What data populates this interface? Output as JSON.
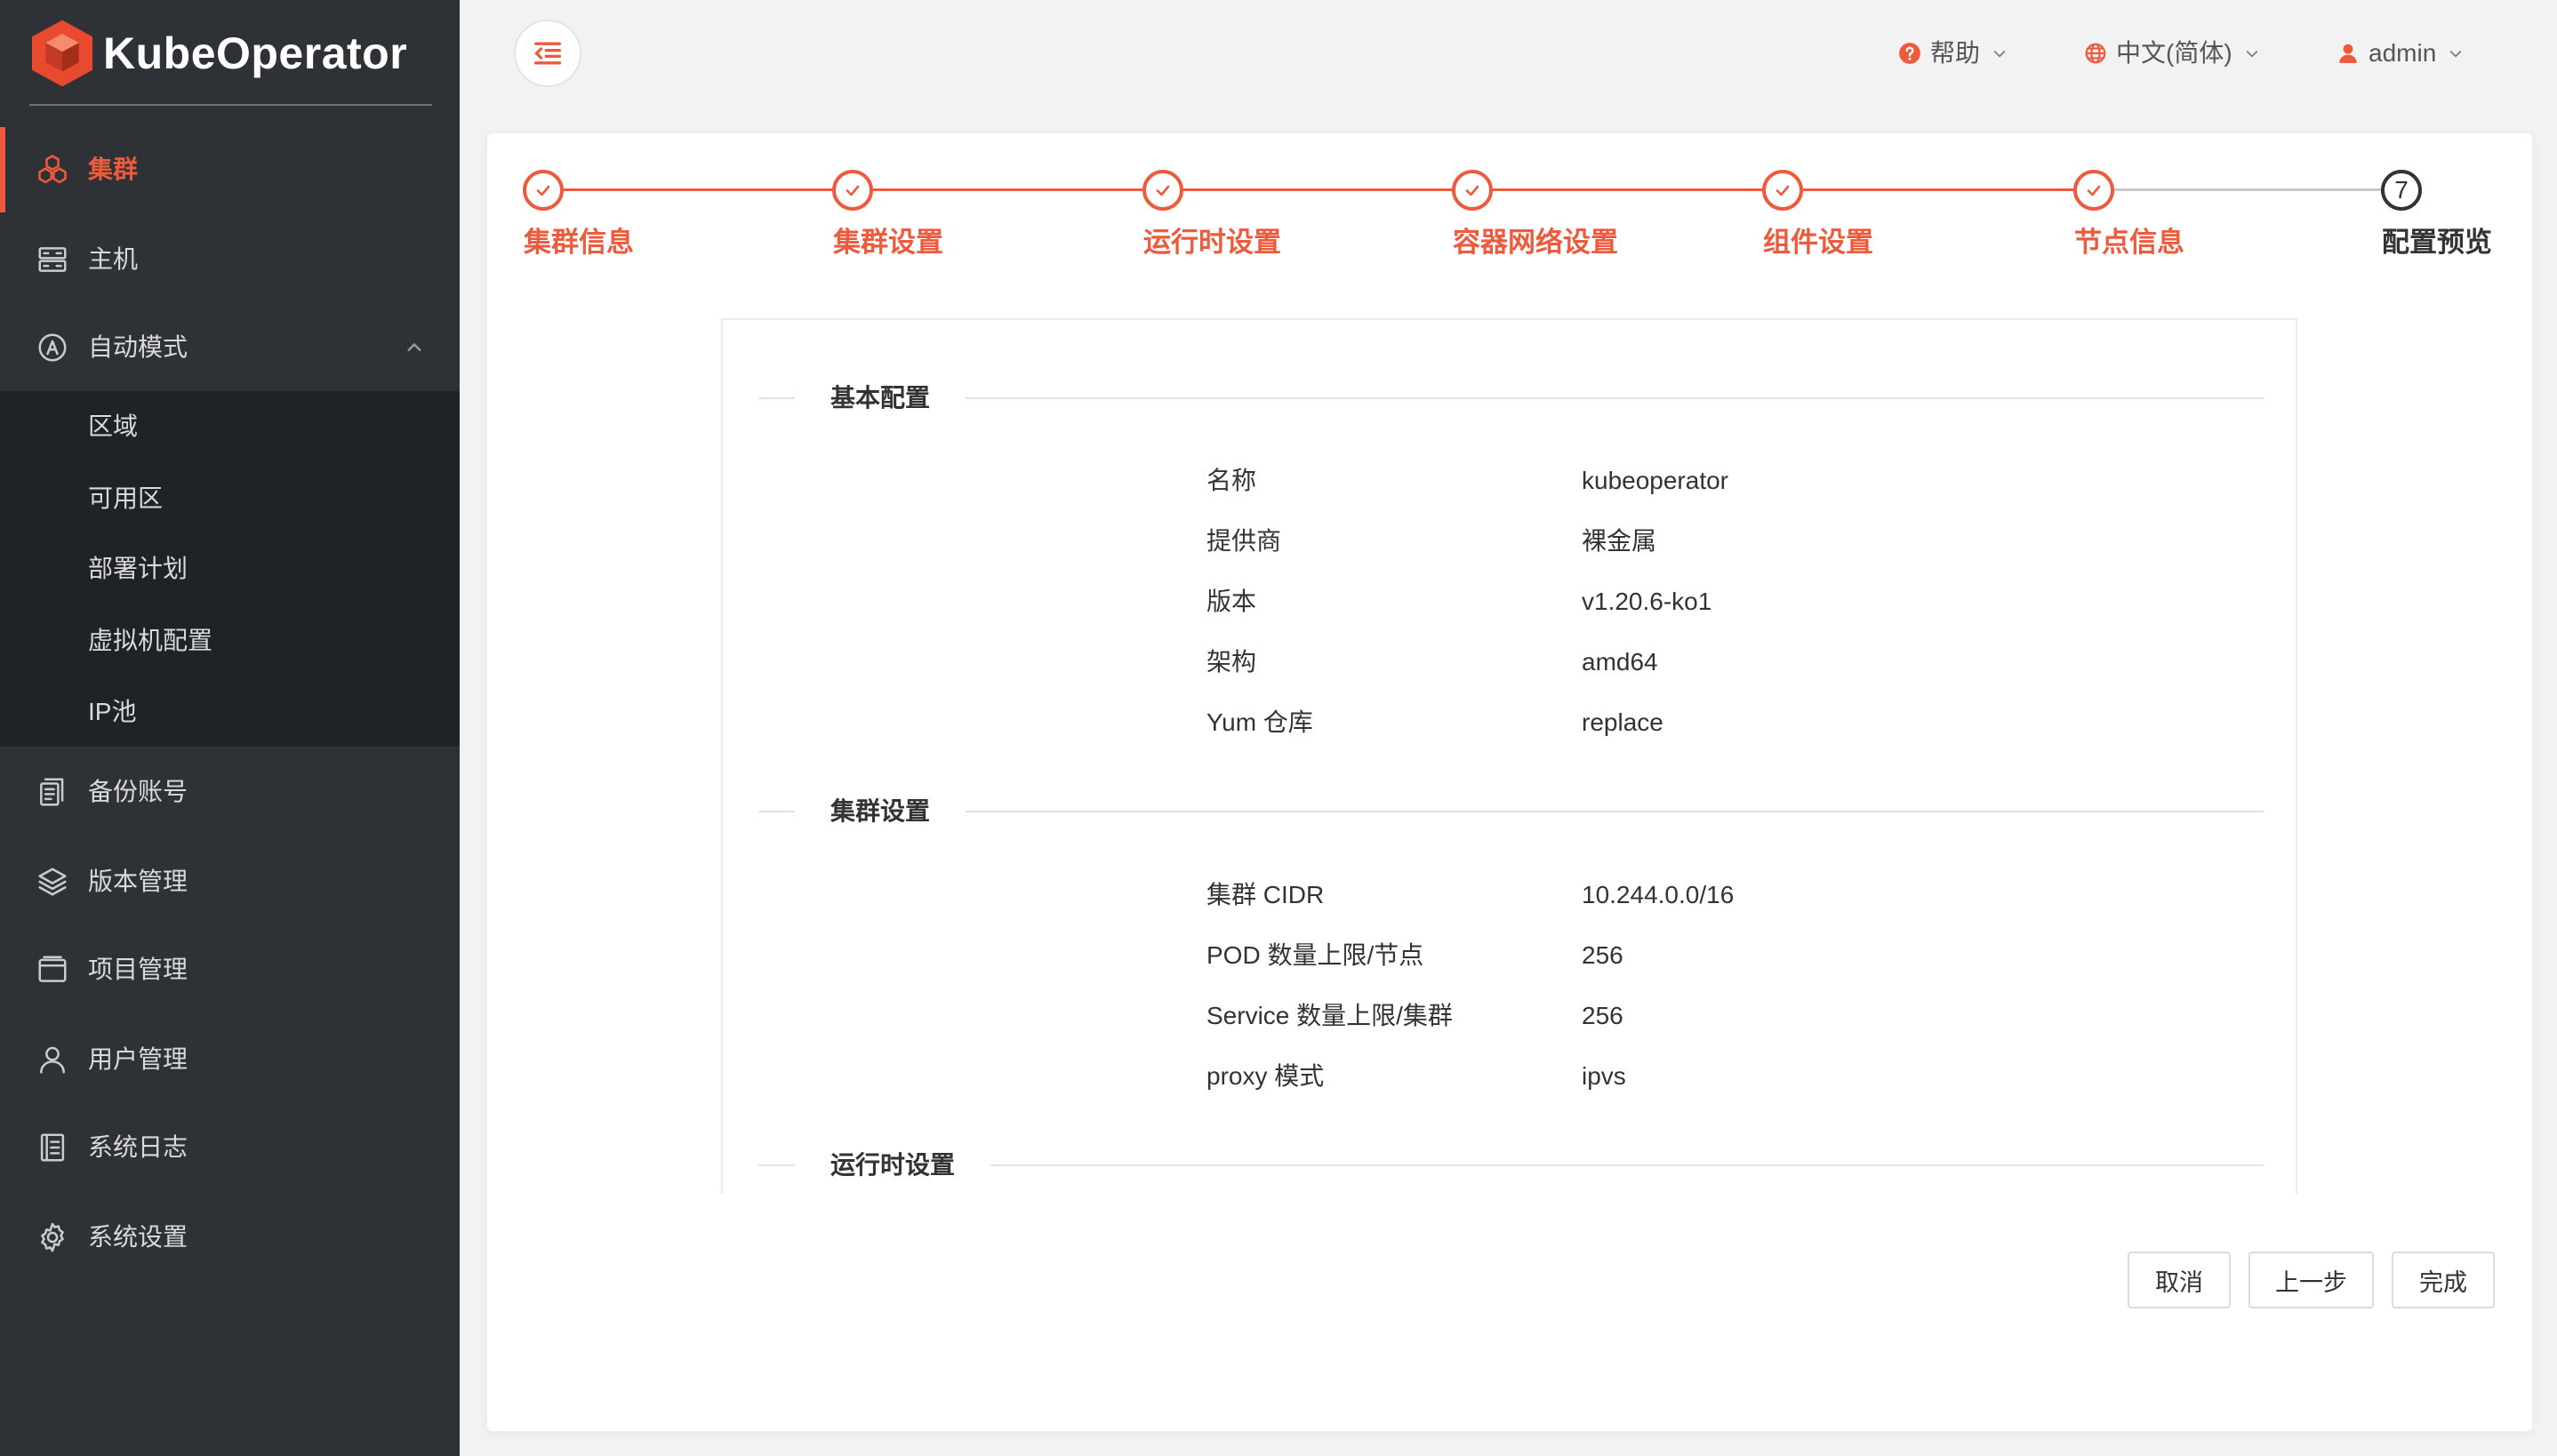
{
  "theme": {
    "accent": "#ee5a3c",
    "sidebar_bg": "#2e3136",
    "submenu_bg": "#1f2226",
    "page_bg": "#f2f2f2"
  },
  "sidebar": {
    "logo_text": "KubeOperator",
    "items": [
      {
        "label": "集群",
        "icon": "cluster-icon",
        "active": true
      },
      {
        "label": "主机",
        "icon": "server-icon"
      },
      {
        "label": "自动模式",
        "icon": "auto-mode-icon",
        "expanded": true,
        "children": [
          {
            "label": "区域"
          },
          {
            "label": "可用区"
          },
          {
            "label": "部署计划"
          },
          {
            "label": "虚拟机配置"
          },
          {
            "label": "IP池"
          }
        ]
      },
      {
        "label": "备份账号",
        "icon": "backup-account-icon"
      },
      {
        "label": "版本管理",
        "icon": "layers-icon"
      },
      {
        "label": "项目管理",
        "icon": "project-icon"
      },
      {
        "label": "用户管理",
        "icon": "user-icon"
      },
      {
        "label": "系统日志",
        "icon": "log-icon"
      },
      {
        "label": "系统设置",
        "icon": "gear-icon"
      }
    ]
  },
  "header": {
    "help_label": "帮助",
    "language_label": "中文(简体)",
    "user_label": "admin"
  },
  "wizard": {
    "steps": [
      {
        "label": "集群信息",
        "status": "done"
      },
      {
        "label": "集群设置",
        "status": "done"
      },
      {
        "label": "运行时设置",
        "status": "done"
      },
      {
        "label": "容器网络设置",
        "status": "done"
      },
      {
        "label": "组件设置",
        "status": "done"
      },
      {
        "label": "节点信息",
        "status": "done"
      },
      {
        "label": "配置预览",
        "status": "current",
        "number": "7"
      }
    ]
  },
  "preview": {
    "sections": [
      {
        "title": "基本配置",
        "rows": [
          {
            "label": "名称",
            "value": "kubeoperator"
          },
          {
            "label": "提供商",
            "value": "裸金属"
          },
          {
            "label": "版本",
            "value": "v1.20.6-ko1"
          },
          {
            "label": "架构",
            "value": "amd64"
          },
          {
            "label": "Yum 仓库",
            "value": "replace"
          }
        ]
      },
      {
        "title": "集群设置",
        "rows": [
          {
            "label": "集群 CIDR",
            "value": "10.244.0.0/16"
          },
          {
            "label": "POD 数量上限/节点",
            "value": "256"
          },
          {
            "label": "Service 数量上限/集群",
            "value": "256"
          },
          {
            "label": "proxy 模式",
            "value": "ipvs"
          }
        ]
      },
      {
        "title": "运行时设置",
        "rows": []
      }
    ]
  },
  "actions": {
    "cancel_label": "取消",
    "prev_label": "上一步",
    "finish_label": "完成"
  }
}
